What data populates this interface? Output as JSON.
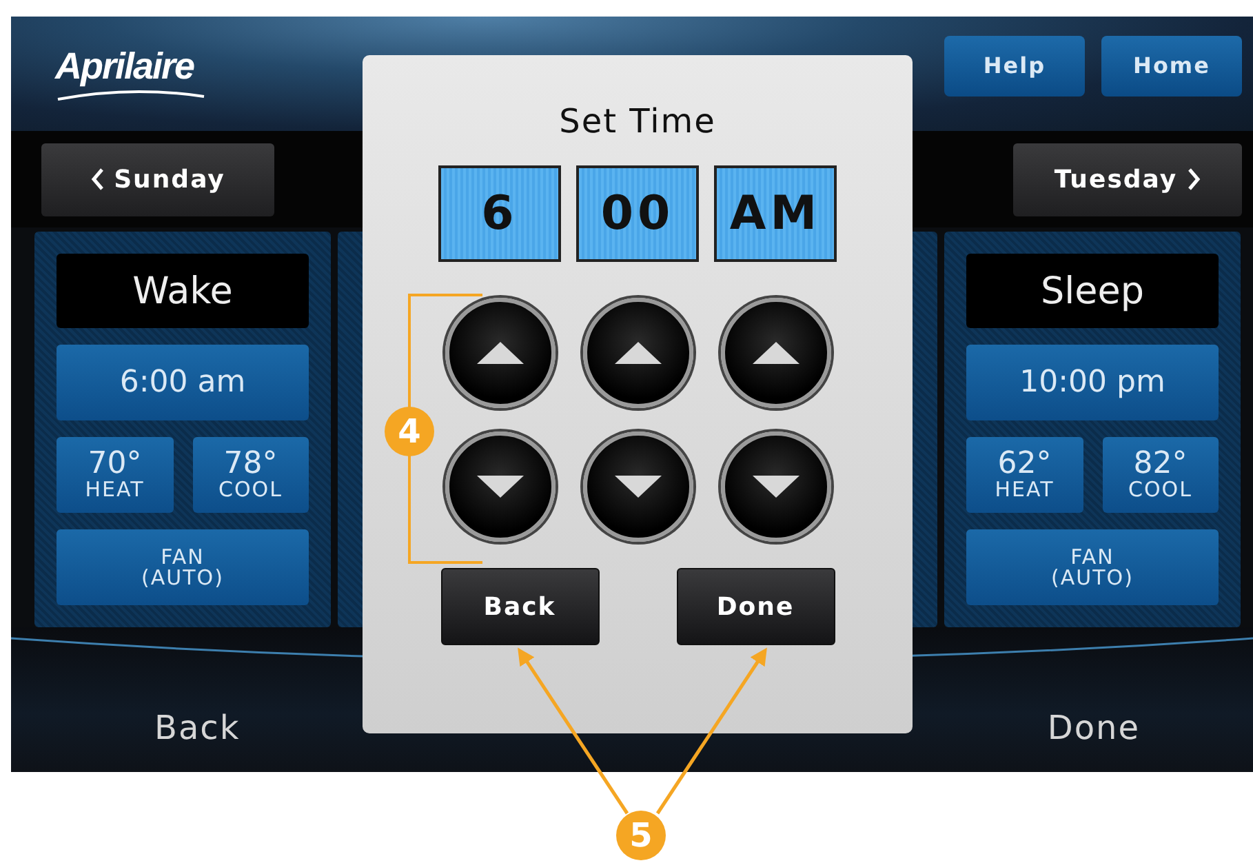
{
  "header": {
    "logo": "Aprilaire",
    "buttons": [
      {
        "label": "Help"
      },
      {
        "label": "Home"
      }
    ]
  },
  "day_nav": {
    "previous": "Sunday",
    "next": "Tuesday"
  },
  "periods": [
    {
      "kind": "full",
      "name": "Wake",
      "time": "6:00 am",
      "heat": "70°",
      "heat_label": "HEAT",
      "cool": "78°",
      "cool_label": "COOL",
      "fan": "FAN",
      "fan_mode": "(AUTO)"
    },
    {
      "kind": "covered"
    },
    {
      "kind": "covered"
    },
    {
      "kind": "full",
      "name": "Sleep",
      "time": "10:00 pm",
      "heat": "62°",
      "heat_label": "HEAT",
      "cool": "82°",
      "cool_label": "COOL",
      "fan": "FAN",
      "fan_mode": "(AUTO)"
    }
  ],
  "bottom_bar": {
    "left": "Back",
    "right": "Done"
  },
  "dialog": {
    "title": "Set Time",
    "fields": [
      {
        "value": "6"
      },
      {
        "value": "00"
      },
      {
        "value": "AM"
      }
    ],
    "buttons": [
      {
        "label": "Back"
      },
      {
        "label": "Done"
      }
    ]
  },
  "callouts": [
    {
      "number": "4"
    },
    {
      "number": "5"
    }
  ]
}
